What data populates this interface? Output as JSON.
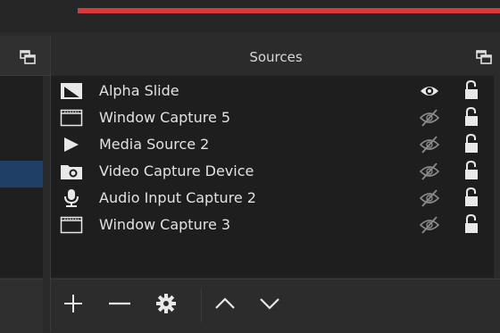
{
  "sources_panel": {
    "title": "Sources",
    "items": [
      {
        "label": "Alpha Slide",
        "type_icon": "image-icon",
        "visible": true
      },
      {
        "label": "Window Capture 5",
        "type_icon": "window-icon",
        "visible": false
      },
      {
        "label": "Media Source 2",
        "type_icon": "play-icon",
        "visible": false
      },
      {
        "label": "Video Capture Device",
        "type_icon": "camera-icon",
        "visible": false
      },
      {
        "label": "Audio Input Capture 2",
        "type_icon": "microphone-icon",
        "visible": false
      },
      {
        "label": "Window Capture 3",
        "type_icon": "window-icon",
        "visible": false
      }
    ],
    "toolbar": [
      "add-icon",
      "remove-icon",
      "gear-icon",
      "move-up-icon",
      "move-down-icon"
    ]
  },
  "colors": {
    "background": "#2b2b2b",
    "list_background": "#1e1e1e",
    "selection": "#1f3f66",
    "accent_red": "#d9393a",
    "text": "#e2e2e2",
    "icon": "#e8e8e8",
    "dim_icon": "#8a8a8a"
  }
}
